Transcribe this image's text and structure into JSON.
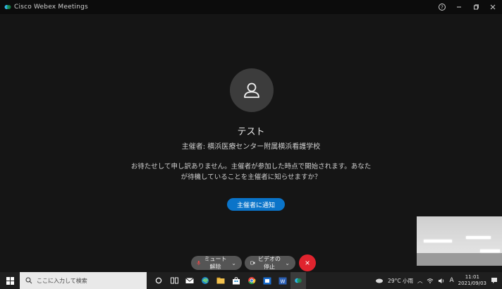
{
  "window": {
    "title": "Cisco Webex Meetings",
    "controls": [
      "help-icon",
      "minimize-icon",
      "restore-icon",
      "close-icon"
    ]
  },
  "meeting": {
    "title": "テスト",
    "host_line": "主催者: 横浜医療センター附属横浜看護学校",
    "message_line1": "お待たせして申し訳ありません。主催者が参加した時点で開始されます。あなた",
    "message_line2": "が待機していることを主催者に知らせますか？",
    "notify_button": "主催者に通知"
  },
  "controls": {
    "mute": "ミュート解除",
    "video": "ビデオの停止",
    "end_icon": "×"
  },
  "taskbar": {
    "search_placeholder": "ここに入力して検索",
    "weather": "29°C 小雨",
    "ime": "A",
    "time": "11:01",
    "date": "2021/09/03"
  },
  "colors": {
    "accent": "#0a74c9",
    "end": "#e0242e",
    "background": "#151515"
  }
}
